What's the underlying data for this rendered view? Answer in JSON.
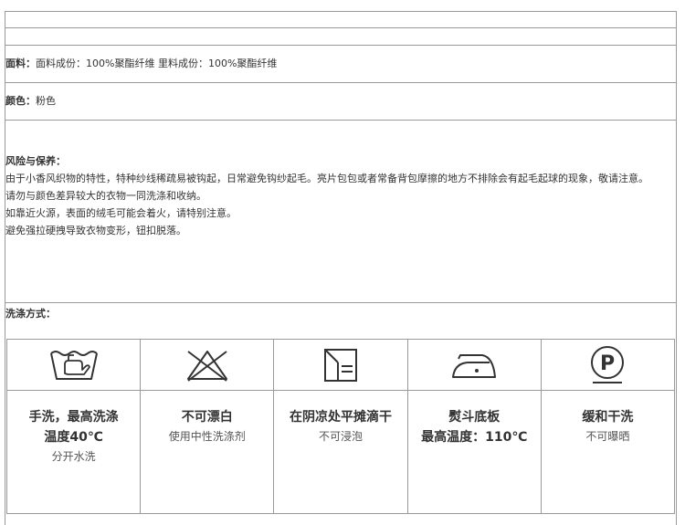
{
  "fabric": {
    "label": "面料：",
    "text": "面料成份：100%聚酯纤维    里料成份：100%聚酯纤维"
  },
  "color": {
    "label": "颜色：",
    "value": "粉色"
  },
  "risk": {
    "title": "风险与保养：",
    "lines": [
      "由于小香风织物的特性，特种纱线稀疏易被钩起，日常避免钩纱起毛。亮片包包或者常备背包摩擦的地方不排除会有起毛起球的现象，敬请注意。",
      "请勿与颜色差异较大的衣物一同洗涤和收纳。",
      "如靠近火源，表面的绒毛可能会着火，请特别注意。",
      "避免强拉硬拽导致衣物变形，钮扣脱落。"
    ]
  },
  "washing": {
    "title": "洗涤方式：",
    "items": [
      {
        "icon": "hand-wash-icon",
        "bold1": "手洗，最高洗涤",
        "bold2": "温度40℃",
        "note": "分开水洗"
      },
      {
        "icon": "no-bleach-icon",
        "bold1": "不可漂白",
        "bold2": "",
        "note": "使用中性洗涤剂"
      },
      {
        "icon": "dry-flat-shade-icon",
        "bold1": "在阴凉处平摊滴干",
        "bold2": "",
        "note": "不可浸泡"
      },
      {
        "icon": "iron-icon",
        "bold1": "熨斗底板",
        "bold2": "最高温度：110℃",
        "note": ""
      },
      {
        "icon": "dry-clean-p-icon",
        "bold1": "缓和干洗",
        "bold2": "",
        "note": "不可曝晒"
      }
    ]
  }
}
